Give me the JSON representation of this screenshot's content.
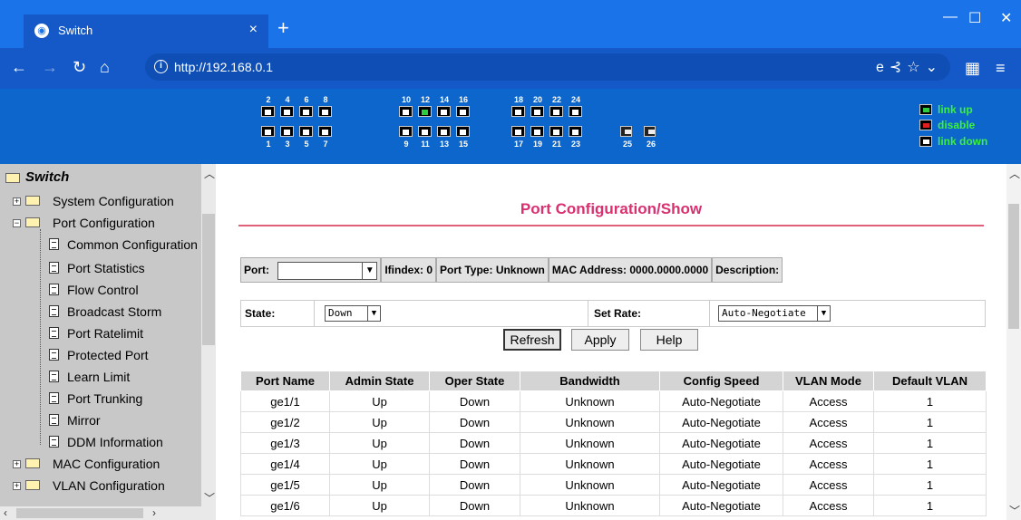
{
  "browser": {
    "tab_title": "Switch",
    "url": "http://192.168.0.1",
    "window_controls": [
      "minimize-icon",
      "maximize-icon",
      "close-icon"
    ]
  },
  "device": {
    "top_port_numbers": [
      "2",
      "4",
      "6",
      "8",
      "10",
      "12",
      "14",
      "16",
      "18",
      "20",
      "22",
      "24"
    ],
    "bottom_port_numbers": [
      "1",
      "3",
      "5",
      "7",
      "9",
      "11",
      "13",
      "15",
      "17",
      "19",
      "21",
      "23",
      "25",
      "26"
    ],
    "link_up_ports": [
      "12"
    ],
    "legend": {
      "link_up": "link up",
      "disable": "disable",
      "link_down": "link down"
    },
    "colors": {
      "header_bg": "#0d66cc",
      "legend_text": "#3cf03c",
      "link_up": "#2ecc40",
      "disable": "#e02020"
    }
  },
  "sidebar": {
    "root": "Switch",
    "items": [
      {
        "label": "System Configuration"
      },
      {
        "label": "Port Configuration"
      },
      {
        "label": "Common Configuration"
      },
      {
        "label": "Port Statistics"
      },
      {
        "label": "Flow Control"
      },
      {
        "label": "Broadcast Storm"
      },
      {
        "label": "Port Ratelimit"
      },
      {
        "label": "Protected Port"
      },
      {
        "label": "Learn Limit"
      },
      {
        "label": "Port Trunking"
      },
      {
        "label": "Mirror"
      },
      {
        "label": "DDM Information"
      },
      {
        "label": "MAC Configuration"
      },
      {
        "label": "VLAN Configuration"
      }
    ]
  },
  "main": {
    "title": "Port Configuration/Show",
    "port_label": "Port:",
    "port_value": "",
    "ifindex": "Ifindex: 0",
    "port_type": "Port Type: Unknown",
    "mac": "MAC Address: 0000.0000.0000",
    "description": "Description:",
    "state_label": "State:",
    "state_value": "Down",
    "rate_label": "Set Rate:",
    "rate_value": "Auto-Negotiate",
    "buttons": {
      "refresh": "Refresh",
      "apply": "Apply",
      "help": "Help"
    },
    "title_color": "#d93070"
  },
  "table": {
    "columns": [
      "Port Name",
      "Admin State",
      "Oper State",
      "Bandwidth",
      "Config Speed",
      "VLAN Mode",
      "Default VLAN"
    ],
    "rows": [
      [
        "ge1/1",
        "Up",
        "Down",
        "Unknown",
        "Auto-Negotiate",
        "Access",
        "1"
      ],
      [
        "ge1/2",
        "Up",
        "Down",
        "Unknown",
        "Auto-Negotiate",
        "Access",
        "1"
      ],
      [
        "ge1/3",
        "Up",
        "Down",
        "Unknown",
        "Auto-Negotiate",
        "Access",
        "1"
      ],
      [
        "ge1/4",
        "Up",
        "Down",
        "Unknown",
        "Auto-Negotiate",
        "Access",
        "1"
      ],
      [
        "ge1/5",
        "Up",
        "Down",
        "Unknown",
        "Auto-Negotiate",
        "Access",
        "1"
      ],
      [
        "ge1/6",
        "Up",
        "Down",
        "Unknown",
        "Auto-Negotiate",
        "Access",
        "1"
      ]
    ]
  }
}
